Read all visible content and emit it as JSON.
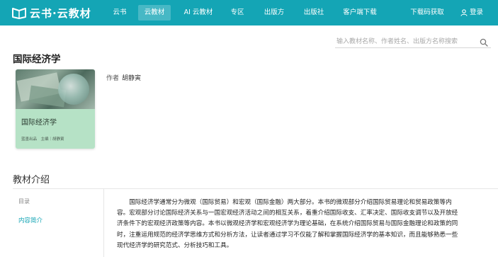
{
  "nav": {
    "logo_text": "云书·云教材",
    "items": [
      {
        "label": "云书"
      },
      {
        "label": "云教材"
      },
      {
        "label": "AI 云教材"
      },
      {
        "label": "专区"
      },
      {
        "label": "出版方"
      },
      {
        "label": "出版社"
      },
      {
        "label": "客户端下载"
      },
      {
        "label": "下载码获取"
      }
    ],
    "active_index": 1,
    "login_label": "登录",
    "bg_color": "#14a5b5"
  },
  "search": {
    "placeholder": "输入教材名称、作者姓名、出版方名称搜索",
    "value": ""
  },
  "book": {
    "title": "国际经济学",
    "author_label": "作者",
    "author_name": "胡静寅",
    "cover": {
      "title": "国际经济学",
      "meta": "蓝墨出品　主编｜胡静寅"
    }
  },
  "intro_section": {
    "heading": "教材介绍",
    "toc_label": "目录",
    "toc_items": [
      {
        "label": "内容简介"
      }
    ],
    "accent_color": "#14a5b5",
    "lines": [
      "国际经济学通常分为微观（国际贸易）和宏观（国际金融）两大部分。本书的微观部分介绍国际贸易理论和贸易政策等内",
      "容。宏观部分讨论国际经济关系与一国宏观经济活动之间的相互关系，着重介绍国际收支、汇率决定、国际收支调节以及开放经",
      "济条件下的宏观经济政策等内容。本书以微观经济学和宏观经济学为理论基础，在系统介绍国际贸易与国际金融理论和政策的同",
      "时，注重运用规范的经济学思维方式和分析方法，让读者通过学习不仅能了解和掌握国际经济学的基本知识，而且能够熟悉一些",
      "现代经济学的研究范式、分析技巧和工具。"
    ]
  }
}
